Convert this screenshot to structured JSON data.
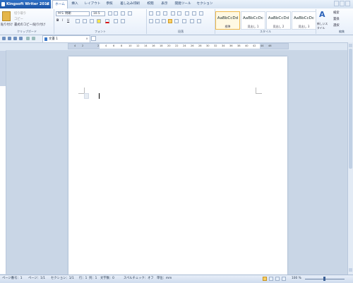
{
  "app": {
    "title": "Kingsoft Writer 2012"
  },
  "menu_tabs": [
    "ホーム",
    "挿入",
    "レイアウト",
    "参照",
    "差し込み印刷",
    "校閲",
    "表示",
    "開発ツール",
    "セクション"
  ],
  "ribbon": {
    "clipboard": {
      "paste": "貼り付け",
      "cut": "切り取り",
      "copy": "コピー",
      "format_copy": "書式のコピー/貼り付け",
      "label": "クリップボード"
    },
    "font": {
      "name": "ＭＳ 明朝",
      "size": "10.5",
      "label": "フォント"
    },
    "paragraph": {
      "label": "段落"
    },
    "styles": {
      "items": [
        {
          "preview": "AaBbCcDd",
          "name": "標準"
        },
        {
          "preview": "AaBbCcDc",
          "name": "見出し 1"
        },
        {
          "preview": "AaBbCcDd",
          "name": "見出し 2"
        },
        {
          "preview": "AaBbCcDc",
          "name": "見出し 3"
        }
      ],
      "new_style": "新しいスタイル",
      "label": "スタイル"
    },
    "editing": {
      "find": "検索",
      "replace": "置換",
      "select": "選択",
      "label": "編集"
    }
  },
  "document_tab": {
    "name": "文書 1"
  },
  "ruler_numbers": [
    "4",
    "2",
    "",
    "2",
    "4",
    "6",
    "8",
    "10",
    "12",
    "14",
    "16",
    "18",
    "20",
    "22",
    "24",
    "26",
    "28",
    "30",
    "32",
    "34",
    "36",
    "38",
    "40",
    "42",
    "44",
    "46"
  ],
  "statusbar": {
    "page": "ページ番号：1",
    "pages": "ページ：1/1",
    "section": "セクション：1/1",
    "row": "行：1",
    "col": "列：1",
    "chars": "文字数：0",
    "spell": "スペルチェック：オフ",
    "unit": "単位：mm",
    "zoom": "100 %"
  }
}
